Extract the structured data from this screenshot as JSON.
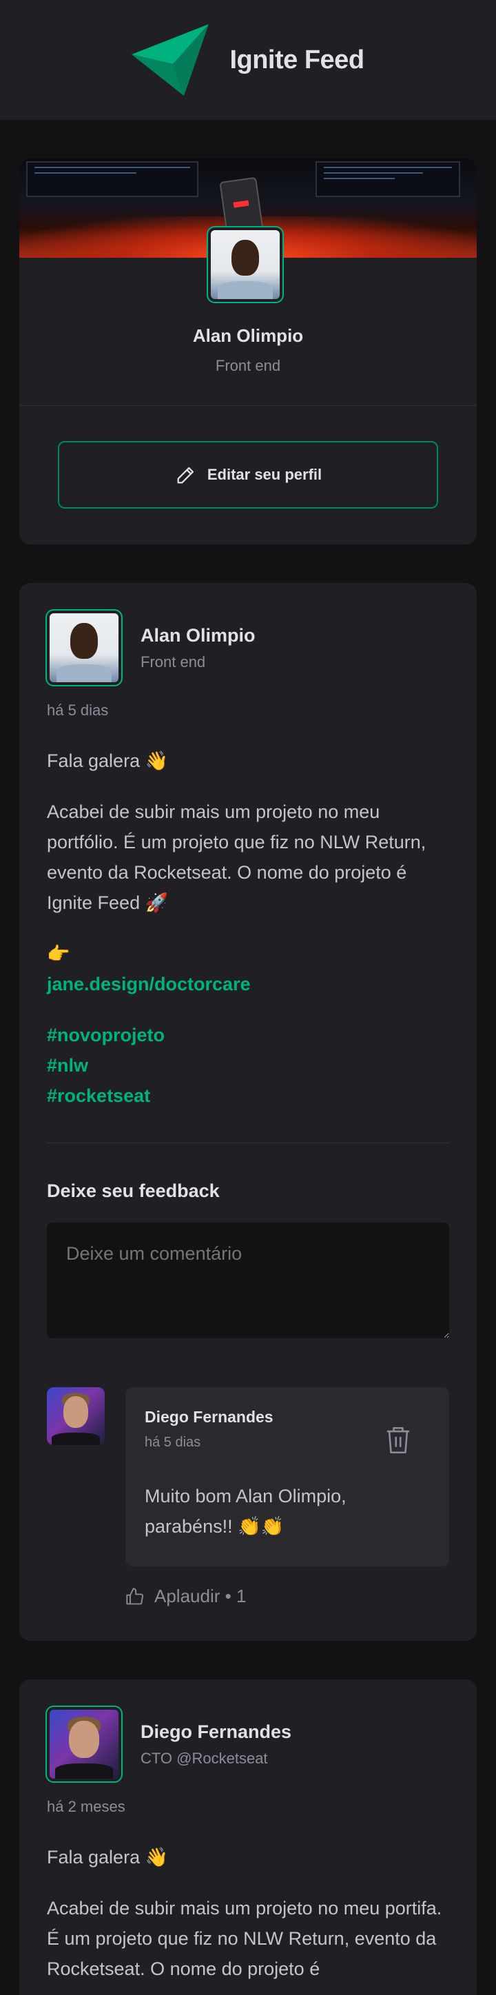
{
  "header": {
    "title": "Ignite Feed",
    "logo_icon": "ignite-logo-icon"
  },
  "profile": {
    "name": "Alan Olimpio",
    "role": "Front end",
    "edit_label": "Editar seu perfil"
  },
  "posts": [
    {
      "author": "Alan Olimpio",
      "role": "Front end",
      "time": "há 5 dias",
      "paragraphs": [
        "Fala galera 👋",
        "Acabei de subir mais um projeto no meu portfólio. É um projeto que fiz no NLW Return, evento da Rocketseat. O nome do projeto é Ignite Feed 🚀",
        "👉"
      ],
      "link": "jane.design/doctorcare",
      "tags": [
        "#novoprojeto",
        "#nlw",
        "#rocketseat"
      ],
      "feedback_title": "Deixe seu feedback",
      "feedback_placeholder": "Deixe um comentário",
      "comments": [
        {
          "author": "Diego Fernandes",
          "time": "há 5 dias",
          "text": "Muito bom Alan Olimpio, parabéns!! 👏👏",
          "applaud": "Aplaudir • 1"
        }
      ]
    },
    {
      "author": "Diego Fernandes",
      "role": "CTO @Rocketseat",
      "time": "há 2 meses",
      "paragraphs": [
        "Fala galera 👋",
        "Acabei de subir mais um projeto no meu portifa. É um projeto que fiz no NLW Return, evento da Rocketseat. O nome do projeto é"
      ]
    }
  ],
  "colors": {
    "accent": "#00b37e",
    "accent_dark": "#00875f",
    "surface": "#202024",
    "background": "#121214"
  }
}
